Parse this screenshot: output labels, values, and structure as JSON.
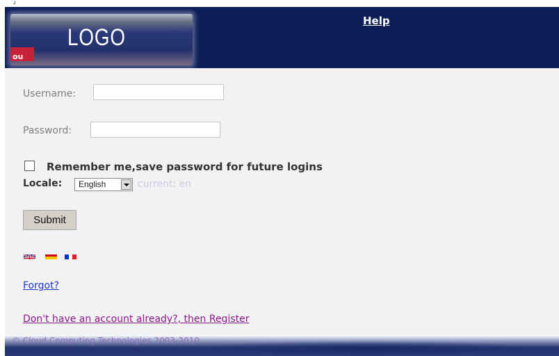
{
  "header": {
    "logo_text": "LOGO",
    "logo_badge": "ou",
    "help_label": "Help"
  },
  "form": {
    "username_label": "Username:",
    "username_value": "",
    "password_label": "Password:",
    "password_value": "",
    "remember_checked": false,
    "remember_label": "Remember me,save password for future logins",
    "locale_label": "Locale:",
    "locale_selected": "English",
    "current_locale": "current: en",
    "submit_label": "Submit"
  },
  "flags": [
    {
      "name": "uk-flag-icon"
    },
    {
      "name": "spain-flag-icon"
    },
    {
      "name": "france-flag-icon"
    }
  ],
  "links": {
    "forgot": "Forgot?",
    "register": "Don't have an account already?, then Register"
  },
  "footer": {
    "copyright": "© Cloud Computing Technologies 2003-2010"
  },
  "colors": {
    "header_bg": "#0e1f57",
    "content_bg": "#f2f2f2",
    "link_blue": "#1b36c8",
    "link_visited": "#8b1a8b"
  }
}
